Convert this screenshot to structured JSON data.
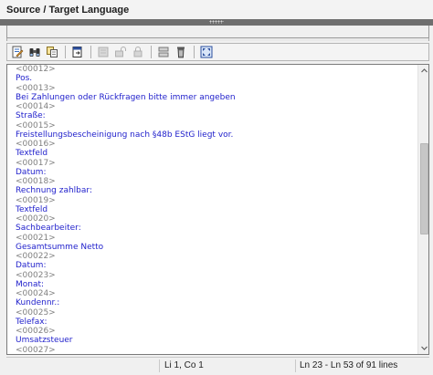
{
  "panel": {
    "title": "Source / Target Language"
  },
  "toolbar": {
    "buttons": [
      {
        "icon": "edit-document-icon",
        "enabled": true
      },
      {
        "icon": "binoculars-icon",
        "enabled": true
      },
      {
        "icon": "copy-icon",
        "enabled": true
      },
      {
        "icon": "export-icon",
        "enabled": true
      },
      {
        "icon": "lock-disabled-icon",
        "enabled": false
      },
      {
        "icon": "unlock-disabled-icon",
        "enabled": false
      },
      {
        "icon": "padlock-disabled-icon",
        "enabled": false
      },
      {
        "icon": "merge-icon",
        "enabled": true
      },
      {
        "icon": "trash-icon",
        "enabled": true
      },
      {
        "icon": "fit-window-icon",
        "enabled": true
      }
    ]
  },
  "editor": {
    "lines": [
      {
        "text": "<00012>",
        "kind": "tag"
      },
      {
        "text": "Pos.",
        "kind": "text"
      },
      {
        "text": "<00013>",
        "kind": "tag"
      },
      {
        "text": "Bei Zahlungen oder Rückfragen bitte immer angeben",
        "kind": "text"
      },
      {
        "text": "<00014>",
        "kind": "tag"
      },
      {
        "text": "Straße:",
        "kind": "text"
      },
      {
        "text": "<00015>",
        "kind": "tag"
      },
      {
        "text": "Freistellungsbescheinigung nach §48b EStG liegt vor.",
        "kind": "text"
      },
      {
        "text": "<00016>",
        "kind": "tag"
      },
      {
        "text": "Textfeld",
        "kind": "text"
      },
      {
        "text": "<00017>",
        "kind": "tag"
      },
      {
        "text": "Datum:",
        "kind": "text"
      },
      {
        "text": "<00018>",
        "kind": "tag"
      },
      {
        "text": "Rechnung zahlbar:",
        "kind": "text"
      },
      {
        "text": "<00019>",
        "kind": "tag"
      },
      {
        "text": "Textfeld",
        "kind": "text"
      },
      {
        "text": "<00020>",
        "kind": "tag"
      },
      {
        "text": "Sachbearbeiter:",
        "kind": "text"
      },
      {
        "text": "<00021>",
        "kind": "tag"
      },
      {
        "text": "Gesamtsumme Netto",
        "kind": "text"
      },
      {
        "text": "<00022>",
        "kind": "tag"
      },
      {
        "text": "Datum:",
        "kind": "text"
      },
      {
        "text": "<00023>",
        "kind": "tag"
      },
      {
        "text": "Monat:",
        "kind": "text"
      },
      {
        "text": "<00024>",
        "kind": "tag"
      },
      {
        "text": "Kundennr.:",
        "kind": "text"
      },
      {
        "text": "<00025>",
        "kind": "tag"
      },
      {
        "text": "Telefax:",
        "kind": "text"
      },
      {
        "text": "<00026>",
        "kind": "tag"
      },
      {
        "text": "Umsatzsteuer",
        "kind": "text"
      },
      {
        "text": "<00027>",
        "kind": "tag"
      }
    ],
    "colors": {
      "tag": "#808080",
      "text": "#2222cc"
    }
  },
  "status": {
    "first": "",
    "position": "Li 1, Co 1",
    "range": "Ln 23 - Ln 53 of 91 lines"
  }
}
